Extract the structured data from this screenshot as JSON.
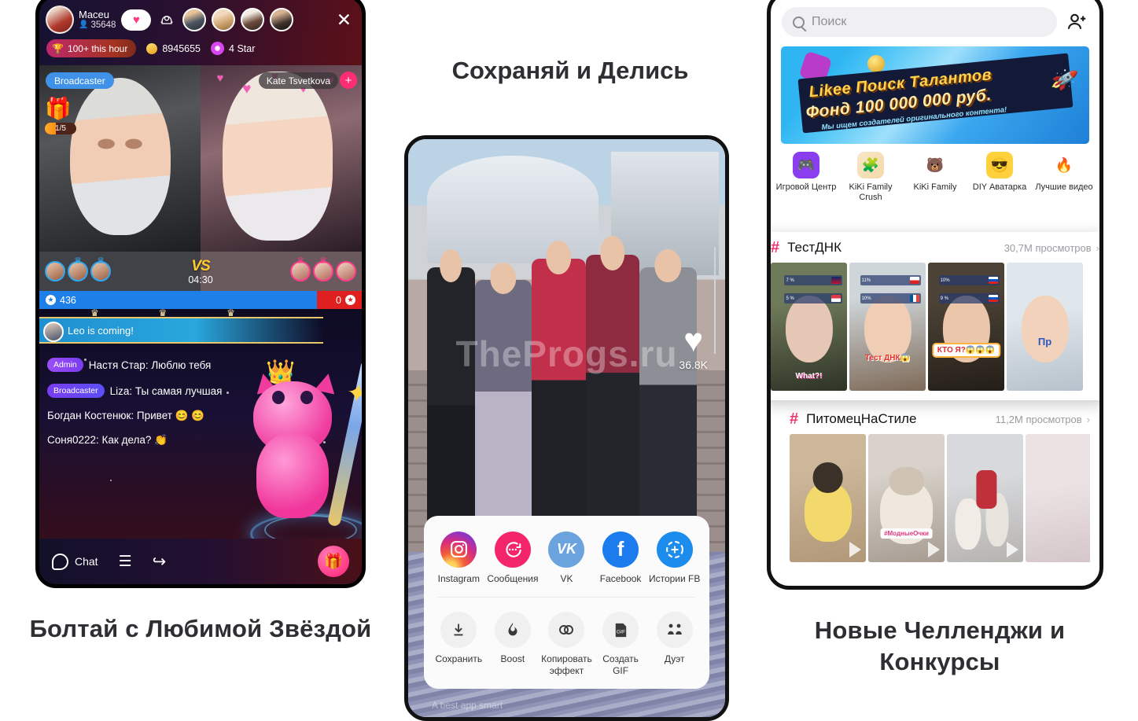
{
  "captions": {
    "left": "Болтай с Любимой Звёздой",
    "center": "Сохраняй и Делись",
    "right": "Новые Челленджи и Конкурсы"
  },
  "live": {
    "host": {
      "name": "Maceu",
      "viewers": "35648"
    },
    "badges": {
      "hour_rank": "100+ this hour",
      "coins": "8945655",
      "star_level": "4 Star"
    },
    "icons": {
      "heart": "heart-icon",
      "helmet": "helmet-icon",
      "close": "✕"
    },
    "video": {
      "left_badge": "Broadcaster",
      "right_badge": "Kate Tsvetkova",
      "plus": "+",
      "gift_progress": "1/5"
    },
    "pk": {
      "vs": "VS",
      "timer": "04:30",
      "left_score": "436",
      "right_score": "0"
    },
    "banner": {
      "text": "Leo is coming!"
    },
    "messages": [
      {
        "tag": "Admin",
        "tag_type": "admin",
        "text": "Настя Стар: Люблю тебя"
      },
      {
        "tag": "Broadcaster",
        "tag_type": "bc",
        "text": "Liza: Ты самая лучшая"
      },
      {
        "tag": "",
        "tag_type": "none",
        "text": "Богдан Костенюк: Привет 😊 😊"
      },
      {
        "tag": "",
        "tag_type": "none",
        "text": "Соня0222: Как дела? 👏"
      }
    ],
    "bottom": {
      "chat_label": "Chat",
      "menu_icon": "hamburger-icon",
      "share_icon": "share-icon",
      "gift_icon": "🎁"
    }
  },
  "share": {
    "watermark": "TheProgs.ru",
    "like_count": "36.8K",
    "footer": "A best app smart",
    "row1": [
      {
        "label": "Instagram",
        "icon": "instagram-icon"
      },
      {
        "label": "Сообщения",
        "icon": "messages-icon"
      },
      {
        "label": "VK",
        "icon": "vk-icon"
      },
      {
        "label": "Facebook",
        "icon": "facebook-icon"
      },
      {
        "label": "Истории FB",
        "icon": "facebook-stories-icon"
      }
    ],
    "row2": [
      {
        "label": "Сохранить",
        "icon": "download-icon"
      },
      {
        "label": "Boost",
        "icon": "flame-icon"
      },
      {
        "label": "Копировать эффект",
        "icon": "copy-effect-icon"
      },
      {
        "label": "Создать GIF",
        "icon": "gif-icon"
      },
      {
        "label": "Дуэт",
        "icon": "duet-icon"
      }
    ]
  },
  "discover": {
    "search_placeholder": "Поиск",
    "add_user_icon": "add-user-icon",
    "banner": {
      "line1": "Likee Поиск Талантов",
      "line2": "Фонд 100 000 000 руб.",
      "line3": "Мы ищем создателей оригинального контента!"
    },
    "quick": [
      {
        "label": "Игровой Центр",
        "icon": "gamepad-icon"
      },
      {
        "label": "KiKi Family Crush",
        "icon": "kiki-crush-icon"
      },
      {
        "label": "KiKi Family",
        "icon": "kiki-icon"
      },
      {
        "label": "DIY Аватарка",
        "icon": "diy-avatar-icon"
      },
      {
        "label": "Лучшие видео",
        "icon": "flame-icon"
      }
    ],
    "hashtags": [
      {
        "title": "ТестДНК",
        "views": "30,7М просмотров",
        "thumbs": [
          {
            "caption": "What?!"
          },
          {
            "caption": "Тест ДНК😱"
          },
          {
            "caption": "КТО Я?😱😱😱"
          },
          {
            "caption": "Пр"
          }
        ]
      },
      {
        "title": "ПитомецНаСтиле",
        "views": "11,2М просмотров",
        "thumbs": [
          {
            "caption": ""
          },
          {
            "caption": "#МодныеОчки"
          },
          {
            "caption": ""
          },
          {
            "caption": ""
          }
        ]
      }
    ]
  }
}
